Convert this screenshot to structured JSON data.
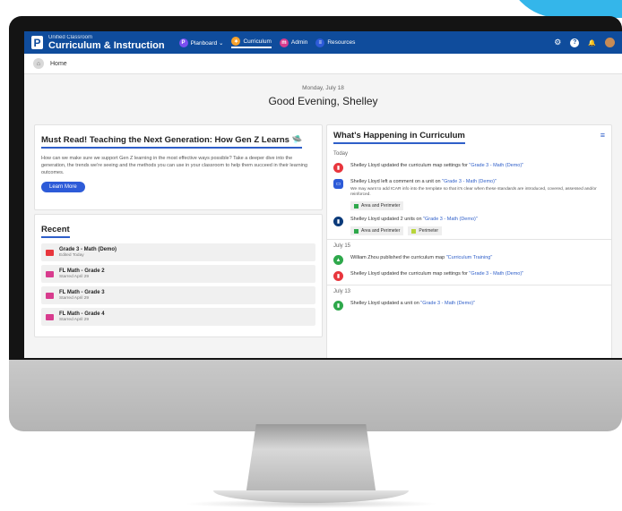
{
  "app": {
    "small_title": "Unified Classroom",
    "title": "Curriculum & Instruction"
  },
  "nav": [
    {
      "label": "Planboard ⌄",
      "badge": "P",
      "color": "#7a4ff0"
    },
    {
      "label": "Curriculum",
      "badge": "✶",
      "color": "#f7a12a"
    },
    {
      "label": "Admin",
      "badge": "m",
      "color": "#d83c8e"
    },
    {
      "label": "Resources",
      "badge": "≡",
      "color": "#2d5bd8"
    }
  ],
  "topicons": {
    "settings": "⚙",
    "help": "?",
    "bell": "🔔"
  },
  "breadcrumb": {
    "home": "Home"
  },
  "greeting": {
    "date": "Monday, July 18",
    "hello": "Good Evening, Shelley"
  },
  "feature": {
    "title": "Must Read! Teaching the Next Generation: How Gen Z Learns 🛸",
    "body": "How can we make sure we support Gen Z learning in the most effective ways possible? Take a deeper dive into the generation, the trends we're seeing and the methods you can use in your classroom to help them succeed in their learning outcomes.",
    "button": "Learn More"
  },
  "recent": {
    "title": "Recent",
    "items": [
      {
        "title": "Grade 3 - Math (Demo)",
        "sub": "Edited Today"
      },
      {
        "title": "FL Math - Grade 2",
        "sub": "Starred April 29"
      },
      {
        "title": "FL Math - Grade 3",
        "sub": "Starred April 29"
      },
      {
        "title": "FL Math - Grade 4",
        "sub": "Starred April 29"
      }
    ]
  },
  "feed": {
    "title": "What's Happening in Curriculum",
    "sections": {
      "today": "Today",
      "jul15": "July 15",
      "jul13": "July 13"
    },
    "items": {
      "a": {
        "pre": "Shelley Lloyd updated the curriculum map settings for ",
        "link": "\"Grade 3 - Math (Demo)\""
      },
      "b": {
        "pre": "Shelley Lloyd left a comment on a unit on ",
        "link": "\"Grade 3 - Math (Demo)\"",
        "comment": "We may want to add ICAR info into the template so that it's clear when these standards are introduced, covered, assessed and/or reinforced.",
        "tag": "Area and Perimeter"
      },
      "c": {
        "pre": "Shelley Lloyd updated 2 units on ",
        "link": "\"Grade 3 - Math (Demo)\"",
        "tag1": "Area and Perimeter",
        "tag2": "Perimeter"
      },
      "d": {
        "pre": "William Zhou published the curriculum map ",
        "link": "\"Curriculum Training\""
      },
      "e": {
        "pre": "Shelley Lloyd updated the curriculum map settings for ",
        "link": "\"Grade 3 - Math (Demo)\""
      },
      "f": {
        "pre": "Shelley Lloyd updated a unit on ",
        "link": "\"Grade 3 - Math (Demo)\""
      }
    }
  },
  "colors": {
    "brand_blue": "#0f4c9c",
    "accent_blue": "#2d5bd8",
    "red": "#e8363d",
    "green": "#2ea84b",
    "navy": "#0b3a7a"
  }
}
